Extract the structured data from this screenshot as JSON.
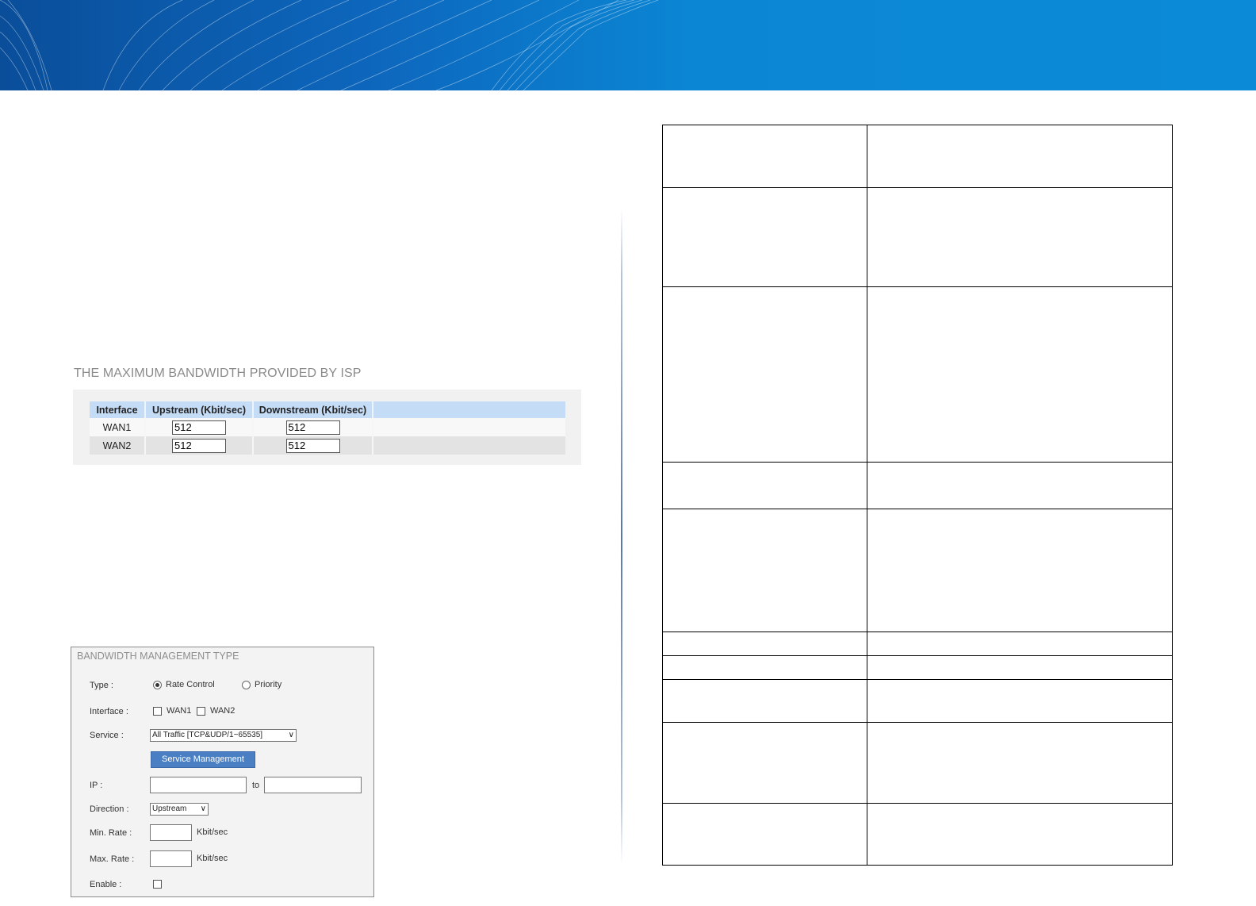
{
  "isp": {
    "title": "THE MAXIMUM BANDWIDTH PROVIDED BY ISP",
    "headers": [
      "Interface",
      "Upstream (Kbit/sec)",
      "Downstream (Kbit/sec)",
      ""
    ],
    "rows": [
      {
        "interface": "WAN1",
        "upstream": "512",
        "downstream": "512"
      },
      {
        "interface": "WAN2",
        "upstream": "512",
        "downstream": "512"
      }
    ]
  },
  "bmt": {
    "title": "BANDWIDTH MANAGEMENT TYPE",
    "type_label": "Type :",
    "type_options": [
      "Rate Control",
      "Priority"
    ],
    "type_selected": "Rate Control",
    "interface_label": "Interface :",
    "interface_options": [
      "WAN1",
      "WAN2"
    ],
    "service_label": "Service :",
    "service_value": "All Traffic [TCP&UDP/1~65535]",
    "service_button": "Service Management",
    "ip_label": "IP :",
    "ip_to": "to",
    "direction_label": "Direction :",
    "direction_value": "Upstream",
    "min_rate_label": "Min. Rate :",
    "max_rate_label": "Max. Rate :",
    "rate_unit": "Kbit/sec",
    "enable_label": "Enable :"
  },
  "colors": {
    "banner": "#0b86d4",
    "button": "#4a7fc4",
    "table_header": "#c5dcf7"
  }
}
